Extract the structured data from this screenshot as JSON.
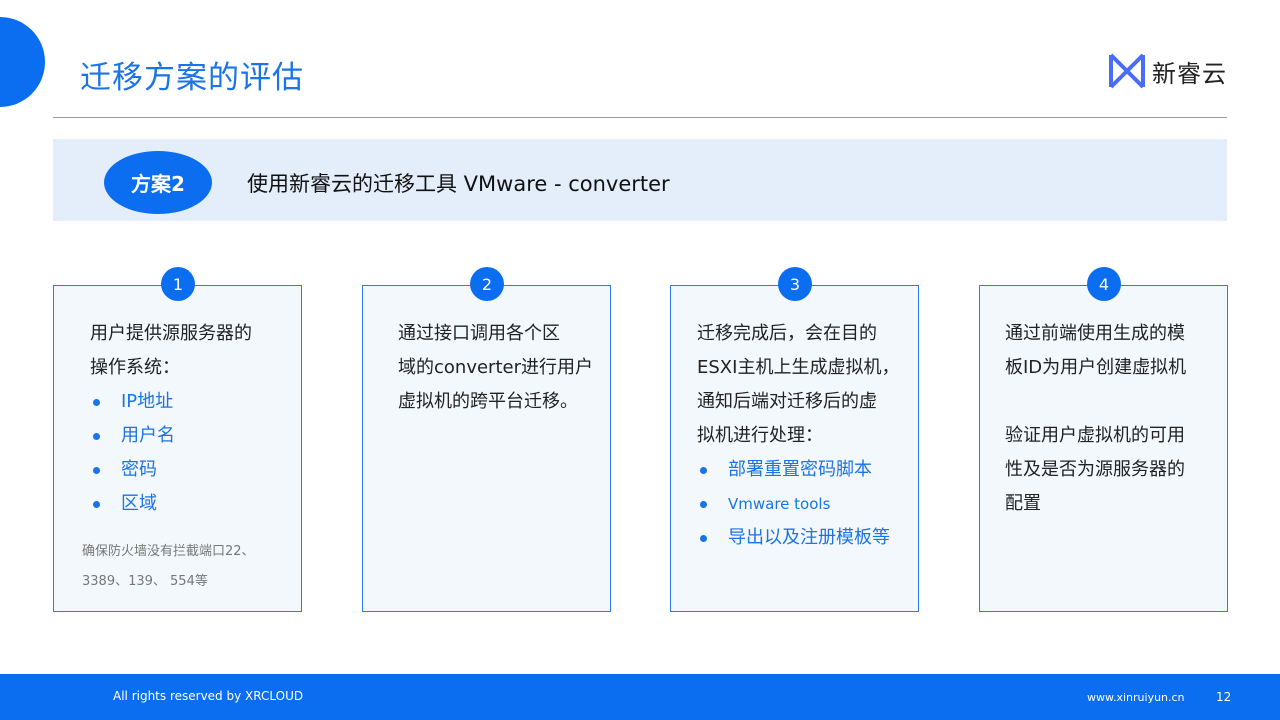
{
  "header": {
    "title": "迁移方案的评估",
    "logo_text": "新睿云",
    "accent_color": "#0b6ef0"
  },
  "plan": {
    "badge": "方案2",
    "description": "使用新睿云的迁移工具 VMware - converter"
  },
  "cards": [
    {
      "number": "1",
      "lines": [
        "用户提供源服务器的",
        "操作系统："
      ],
      "bullets": [
        "IP地址",
        "用户名",
        "密码",
        "区域"
      ],
      "note_lines": [
        "确保防火墙没有拦截端口22、",
        "3389、139、 554等"
      ]
    },
    {
      "number": "2",
      "lines": [
        "通过接口调用各个区",
        "域的converter进行用户",
        "虚拟机的跨平台迁移。"
      ]
    },
    {
      "number": "3",
      "lines": [
        "迁移完成后，会在目的",
        "ESXI主机上生成虚拟机，",
        "通知后端对迁移后的虚",
        "拟机进行处理："
      ],
      "bullets": [
        "部署重置密码脚本",
        "Vmware tools",
        "导出以及注册模板等"
      ]
    },
    {
      "number": "4",
      "lines": [
        "通过前端使用生成的模",
        "板ID为用户创建虚拟机"
      ],
      "lines_b": [
        "验证用户虚拟机的可用",
        "性及是否为源服务器的",
        "配置"
      ]
    }
  ],
  "footer": {
    "copyright": "All rights reserved by XRCLOUD",
    "url": "www.xinruiyun.cn",
    "page": "12"
  }
}
